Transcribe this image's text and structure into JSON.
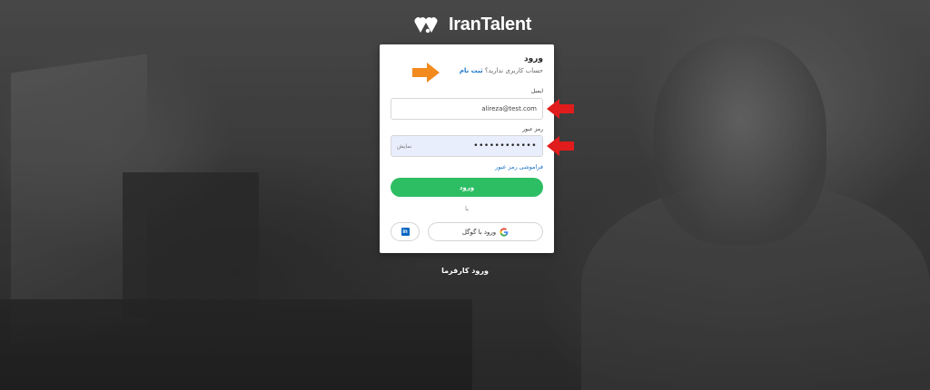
{
  "brand": {
    "name": "IranTalent"
  },
  "login": {
    "title": "ورود",
    "no_account_text": "حساب کاربری ندارید؟",
    "register_link": "ثبت نام",
    "email_label": "ایمیل",
    "email_value": "alireza@test.com",
    "password_label": "رمز عبور",
    "password_masked": "••••••••••••",
    "show_password": "نمایش",
    "forgot_password": "فراموشی رمز عبور",
    "submit_label": "ورود",
    "or_text": "یا",
    "google_label": "ورود با گوگل",
    "linkedin_icon_text": "in"
  },
  "footer": {
    "employer_login": "ورود کارفرما"
  },
  "colors": {
    "accent_green": "#2dbe64",
    "link_blue": "#1a73c9",
    "arrow_orange": "#f28a1e",
    "arrow_red": "#e11c1c"
  },
  "icons": {
    "logo": "irantalent-hearts-icon",
    "google": "google-g-icon",
    "linkedin": "linkedin-icon",
    "annotation_arrows": [
      "orange-arrow-icon",
      "red-arrow-icon",
      "red-arrow-icon"
    ]
  }
}
